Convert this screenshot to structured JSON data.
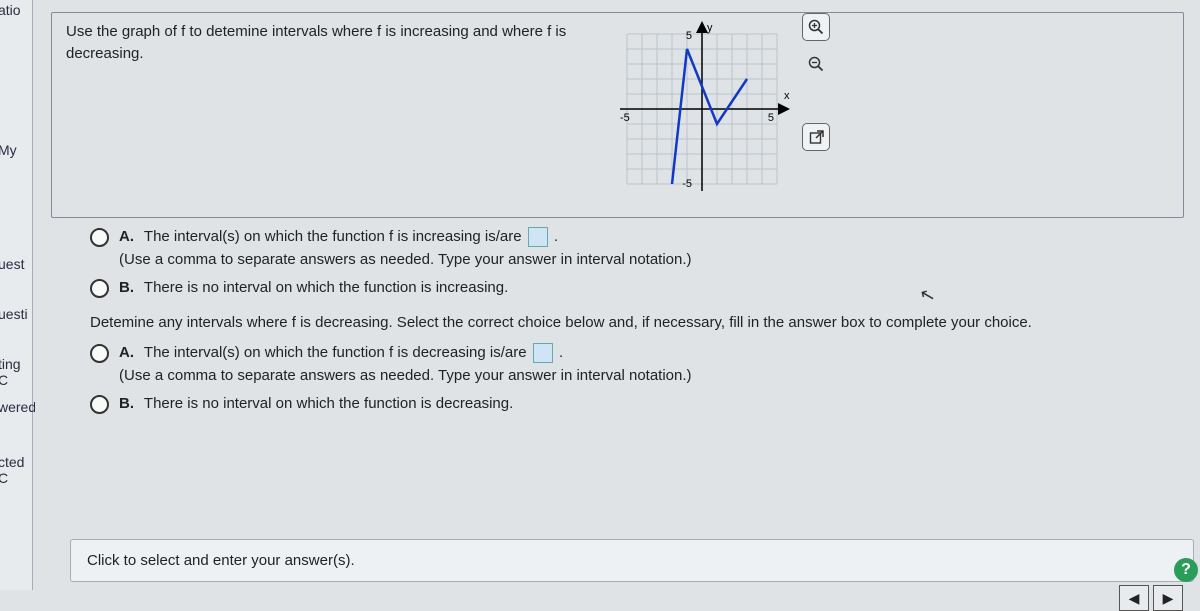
{
  "chart_data": {
    "type": "line",
    "title": "",
    "xlabel": "x",
    "ylabel": "y",
    "xlim": [
      -6,
      6
    ],
    "ylim": [
      -6,
      6
    ],
    "x_ticks": [
      -5,
      5
    ],
    "y_ticks": [
      -5,
      5
    ],
    "series": [
      {
        "name": "f",
        "x": [
          -2,
          -1,
          1,
          3
        ],
        "y": [
          -5,
          4,
          -1,
          2
        ]
      }
    ]
  },
  "left_labels": {
    "l0": "atio",
    "l1": "My",
    "l2": "uest",
    "l3": "uesti",
    "l4": "ting C",
    "l5": "wered",
    "l6": "cted C"
  },
  "prompt": "Use the graph of f to detemine intervals where f is increasing and where f is decreasing.",
  "q1": {
    "a_letter": "A.",
    "a_text_1": "The interval(s) on which the function f is increasing is/are ",
    "a_text_2": ".",
    "a_hint": "(Use a comma to separate answers as needed. Type your answer in interval notation.)",
    "b_letter": "B.",
    "b_text": "There is no interval on which the function is increasing."
  },
  "q2": {
    "instruction": "Detemine any intervals where f is decreasing. Select the correct choice below and, if necessary, fill in the answer box to complete your choice.",
    "a_letter": "A.",
    "a_text_1": "The interval(s) on which the function f is decreasing is/are ",
    "a_text_2": ".",
    "a_hint": "(Use a comma to separate answers as needed. Type your answer in interval notation.)",
    "b_letter": "B.",
    "b_text": "There is no interval on which the function is decreasing."
  },
  "bottom_bar": "Click to select and enter your answer(s).",
  "nav": {
    "prev": "◀",
    "next": "▶"
  },
  "help": "?",
  "axis": {
    "x": "x",
    "y": "y",
    "xt1": "-5",
    "xt2": "5",
    "yt1": "5",
    "yt2": "-5"
  }
}
